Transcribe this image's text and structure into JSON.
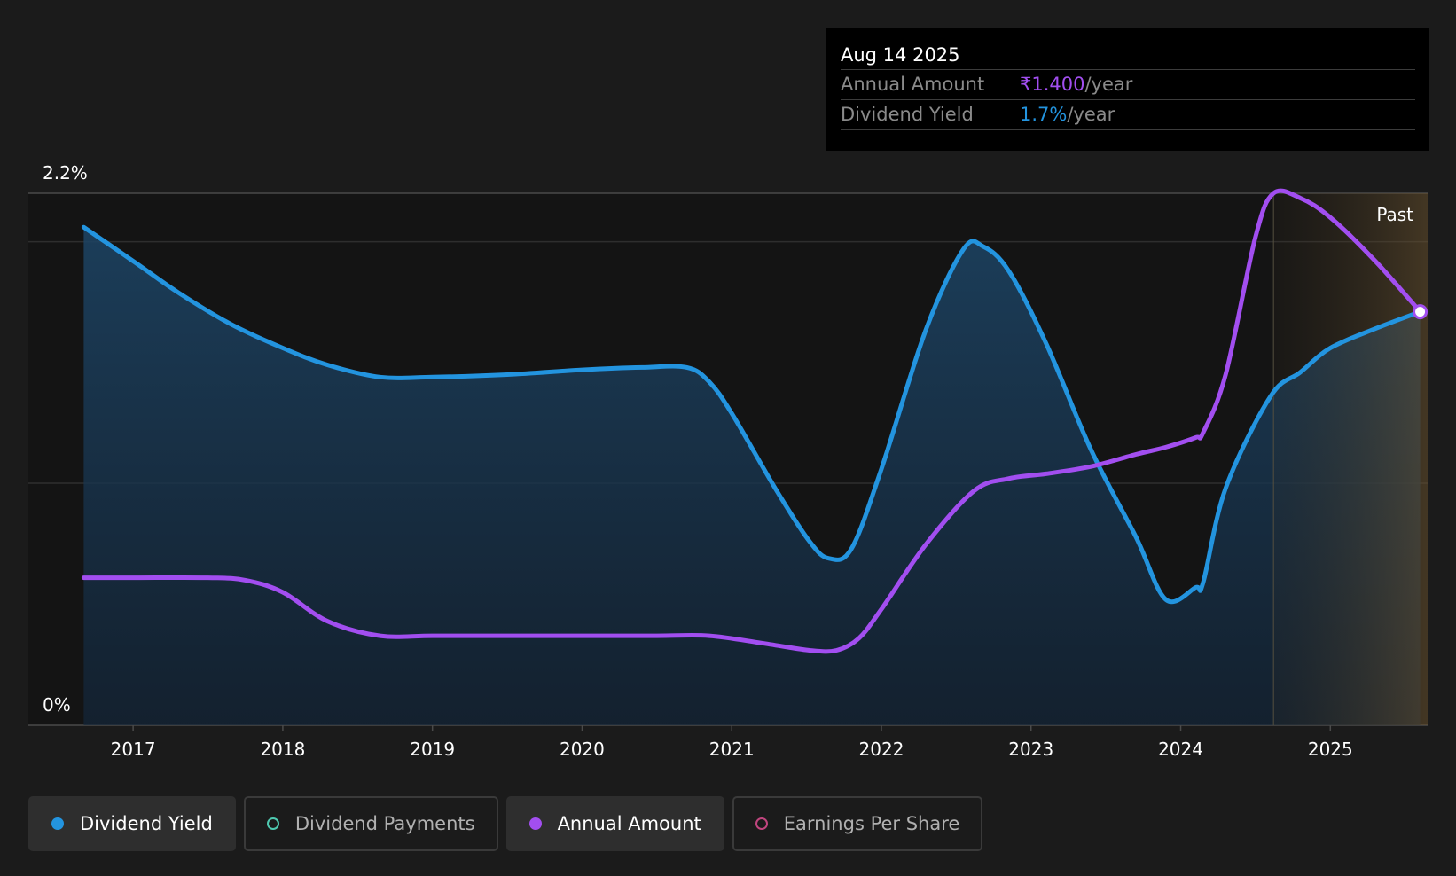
{
  "chart_data": {
    "type": "line",
    "x_range": [
      2016.3,
      2025.65
    ],
    "y_range": [
      0,
      2.2
    ],
    "y_top_label": "2.2%",
    "y_bottom_label": "0%",
    "x_ticks": [
      "2017",
      "2018",
      "2019",
      "2020",
      "2021",
      "2022",
      "2023",
      "2024",
      "2025"
    ],
    "past_label": "Past",
    "past_start": 2024.62,
    "grid": true,
    "series": [
      {
        "name": "Dividend Yield",
        "color": "#2394df",
        "filled": true,
        "x": [
          2016.67,
          2017.0,
          2017.3,
          2017.65,
          2018.0,
          2018.3,
          2018.65,
          2019.0,
          2019.5,
          2020.0,
          2020.4,
          2020.7,
          2020.85,
          2021.0,
          2021.3,
          2021.52,
          2021.65,
          2021.8,
          2022.0,
          2022.3,
          2022.55,
          2022.68,
          2022.85,
          2023.1,
          2023.4,
          2023.7,
          2023.9,
          2024.1,
          2024.15,
          2024.3,
          2024.6,
          2024.8,
          2025.0,
          2025.3,
          2025.6
        ],
        "values": [
          2.06,
          1.92,
          1.79,
          1.66,
          1.56,
          1.49,
          1.44,
          1.44,
          1.45,
          1.47,
          1.48,
          1.48,
          1.42,
          1.29,
          0.97,
          0.76,
          0.69,
          0.73,
          1.06,
          1.64,
          1.97,
          1.98,
          1.88,
          1.58,
          1.14,
          0.78,
          0.52,
          0.57,
          0.59,
          0.98,
          1.36,
          1.46,
          1.56,
          1.64,
          1.71
        ]
      },
      {
        "name": "Annual Amount",
        "color": "#a24ef0",
        "filled": false,
        "x": [
          2016.67,
          2017.0,
          2017.5,
          2017.75,
          2018.0,
          2018.3,
          2018.65,
          2019.0,
          2019.5,
          2020.0,
          2020.5,
          2020.85,
          2021.2,
          2021.52,
          2021.7,
          2021.85,
          2022.0,
          2022.3,
          2022.62,
          2022.85,
          2023.1,
          2023.4,
          2023.7,
          2023.9,
          2024.1,
          2024.15,
          2024.3,
          2024.5,
          2024.62,
          2024.8,
          2025.0,
          2025.3,
          2025.6
        ],
        "values": [
          0.61,
          0.61,
          0.61,
          0.6,
          0.55,
          0.43,
          0.37,
          0.37,
          0.37,
          0.37,
          0.37,
          0.37,
          0.34,
          0.31,
          0.31,
          0.36,
          0.48,
          0.75,
          0.97,
          1.02,
          1.04,
          1.07,
          1.12,
          1.15,
          1.19,
          1.21,
          1.45,
          2.02,
          2.2,
          2.18,
          2.1,
          1.92,
          1.71
        ]
      }
    ]
  },
  "tooltip": {
    "date": "Aug 14 2025",
    "rows": [
      {
        "label": "Annual Amount",
        "value": "₹1.400",
        "unit": "/year",
        "color": "#a24ef0"
      },
      {
        "label": "Dividend Yield",
        "value": "1.7%",
        "unit": "/year",
        "color": "#2394df"
      }
    ]
  },
  "legend": [
    {
      "label": "Dividend Yield",
      "color": "#2394df",
      "active": true,
      "hollow": false
    },
    {
      "label": "Dividend Payments",
      "color": "#4ec9b0",
      "active": false,
      "hollow": true
    },
    {
      "label": "Annual Amount",
      "color": "#a24ef0",
      "active": true,
      "hollow": false
    },
    {
      "label": "Earnings Per Share",
      "color": "#c0457e",
      "active": false,
      "hollow": true
    }
  ]
}
